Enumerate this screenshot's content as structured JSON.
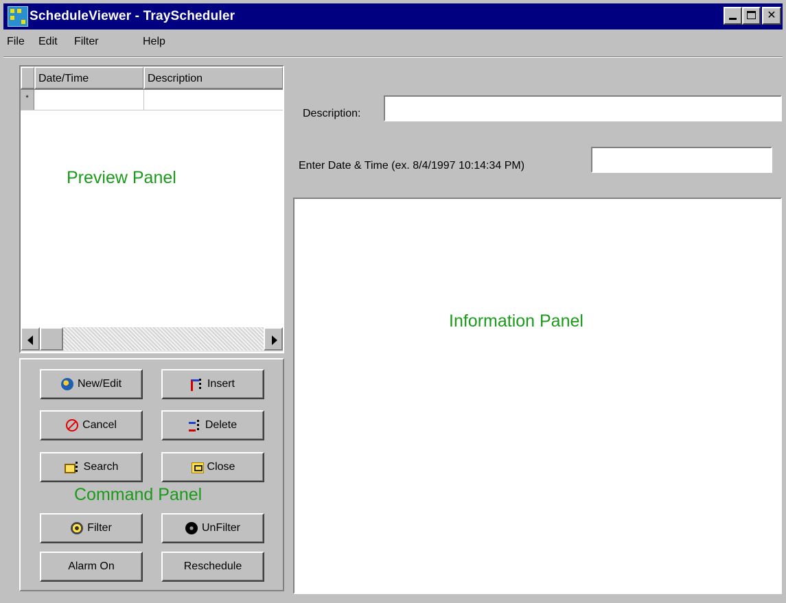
{
  "window": {
    "title": "ScheduleViewer - TrayScheduler"
  },
  "menu": [
    "File",
    "Edit",
    "Filter",
    "Help"
  ],
  "preview_panel": {
    "columns": [
      "Date/Time",
      "Description"
    ],
    "new_row_marker": "*",
    "annotation": "Preview Panel"
  },
  "command_panel": {
    "annotation": "Command Panel",
    "buttons": {
      "new_edit": "New/Edit",
      "insert": "Insert",
      "cancel": "Cancel",
      "delete": "Delete",
      "search": "Search",
      "close": "Close",
      "filter": "Filter",
      "unfilter": "UnFilter",
      "alarm_on": "Alarm On",
      "reschedule": "Reschedule"
    }
  },
  "form": {
    "description_label": "Description:",
    "description_value": "",
    "datetime_label": "Enter Date & Time (ex. 8/4/1997 10:14:34 PM)",
    "datetime_value": ""
  },
  "information_panel": {
    "annotation": "Information Panel"
  },
  "colors": {
    "titlebar": "#000080",
    "annotation_green": "#1a9a1a",
    "face": "#c0c0c0"
  }
}
